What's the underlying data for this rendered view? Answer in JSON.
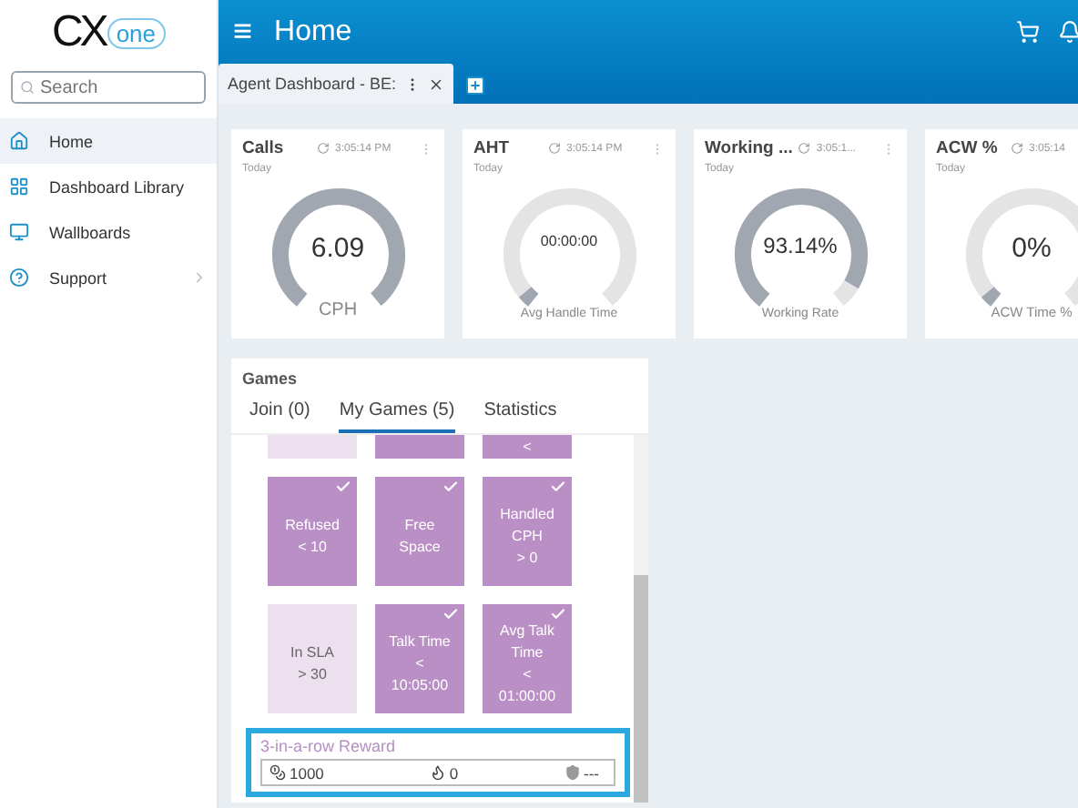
{
  "logo": {
    "text": "CX",
    "badge": "one"
  },
  "search": {
    "placeholder": "Search"
  },
  "nav": [
    {
      "label": "Home",
      "kind": "home",
      "selected": true,
      "submenu": false
    },
    {
      "label": "Dashboard Library",
      "kind": "library",
      "selected": false,
      "submenu": false
    },
    {
      "label": "Wallboards",
      "kind": "wallboard",
      "selected": false,
      "submenu": false
    },
    {
      "label": "Support",
      "kind": "support",
      "selected": false,
      "submenu": true
    }
  ],
  "header": {
    "menu_glyph": "≡",
    "title": "Home"
  },
  "tabs": [
    {
      "label": "Agent Dashboard - BE:",
      "selected": true
    }
  ],
  "widgets": [
    {
      "title": "Calls",
      "time": "3:05:14 PM",
      "period": "Today",
      "value": "6.09",
      "caption": "CPH",
      "level": 1.0
    },
    {
      "title": "AHT",
      "time": "3:05:14 PM",
      "period": "Today",
      "value": "00:00:00",
      "caption": "Avg Handle Time",
      "level": 0.04
    },
    {
      "title": "Working ...",
      "time": "3:05:1...",
      "period": "Today",
      "value": "93.14%",
      "caption": "Working Rate",
      "level": 0.93
    },
    {
      "title": "ACW %",
      "time": "3:05:14",
      "period": "Today",
      "value": "0%",
      "caption": "ACW Time %",
      "level": 0.04
    }
  ],
  "games": {
    "title": "Games",
    "tabs": [
      {
        "label": "Join (0)",
        "selected": false
      },
      {
        "label": "My Games (5)",
        "selected": true
      },
      {
        "label": "Statistics",
        "selected": false
      }
    ],
    "tiles": [
      {
        "checked": false
      },
      {
        "checked": true
      },
      {
        "lines": [
          "<"
        ],
        "checked": true
      },
      {
        "lines": [
          "Refused",
          "< 10"
        ],
        "checked": true
      },
      {
        "lines": [
          "Free",
          "Space"
        ],
        "checked": true
      },
      {
        "lines": [
          "Handled",
          "CPH",
          "> 0"
        ],
        "checked": true
      },
      {
        "lines": [
          "In SLA",
          "> 30"
        ],
        "checked": false
      },
      {
        "lines": [
          "Talk Time",
          "<",
          "10:05:00"
        ],
        "checked": true
      },
      {
        "lines": [
          "Avg Talk",
          "Time",
          "<",
          "01:00:00"
        ],
        "checked": true
      }
    ],
    "reward": {
      "title": "3-in-a-row Reward",
      "coins": "1000",
      "streak": "0",
      "badge": "---"
    }
  }
}
